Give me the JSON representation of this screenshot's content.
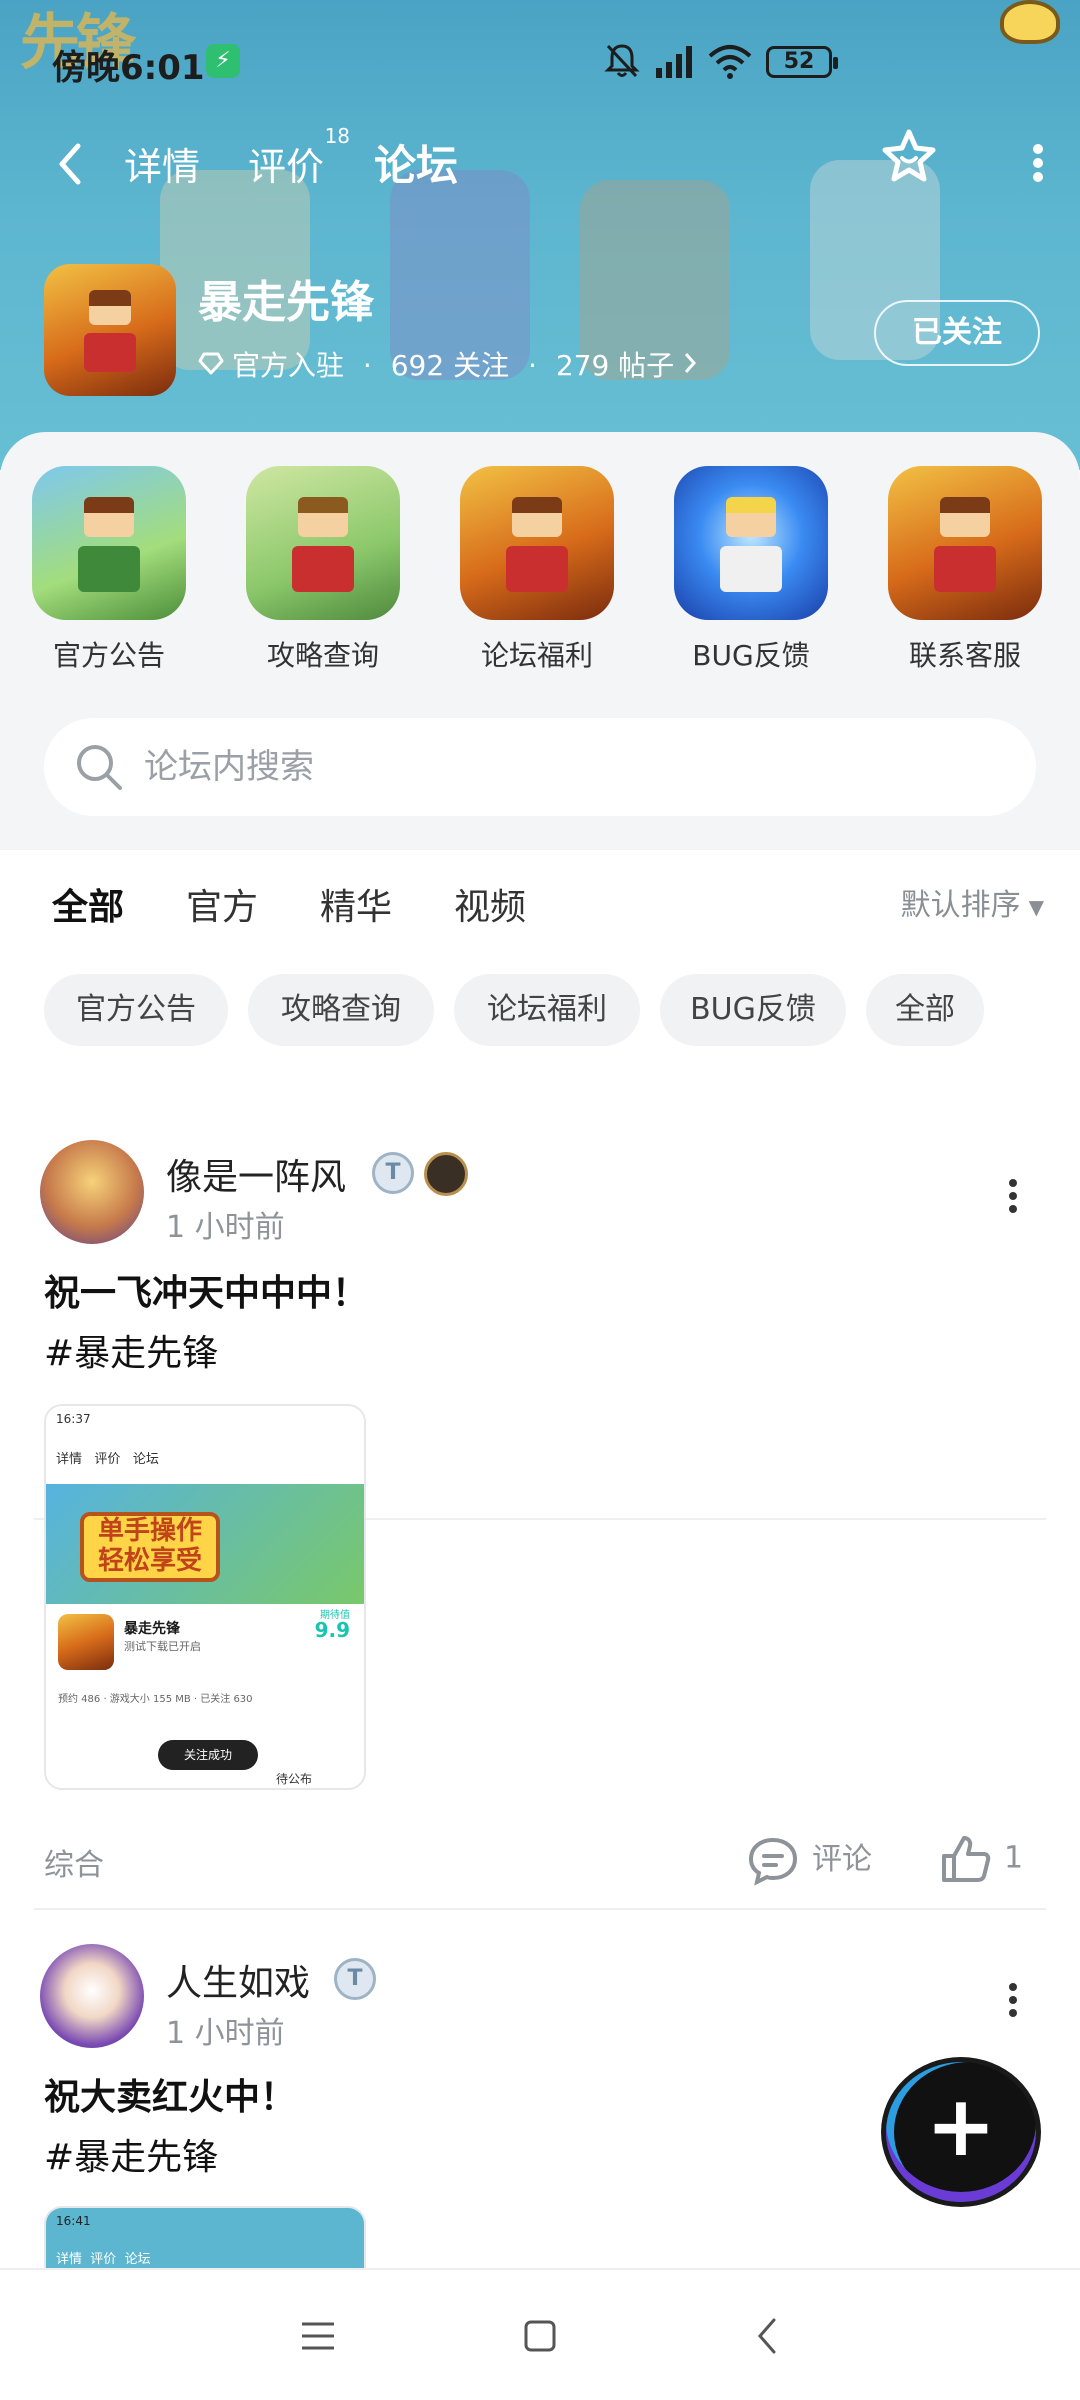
{
  "status": {
    "time": "傍晚6:01",
    "battery": "52"
  },
  "header": {
    "tabs": {
      "detail": "详情",
      "review": "评价",
      "review_count": "18",
      "forum": "论坛"
    },
    "game": {
      "name": "暴走先锋",
      "official": "官方入驻",
      "follows": "692 关注",
      "posts": "279 帖子",
      "separator": "·"
    },
    "follow_button": "已关注",
    "corner_logo": "先锋"
  },
  "shortcuts": [
    {
      "label": "官方公告"
    },
    {
      "label": "攻略查询"
    },
    {
      "label": "论坛福利"
    },
    {
      "label": "BUG反馈"
    },
    {
      "label": "联系客服"
    }
  ],
  "search": {
    "placeholder": "论坛内搜索"
  },
  "feed_tabs": {
    "all": "全部",
    "official": "官方",
    "featured": "精华",
    "video": "视频",
    "sort": "默认排序"
  },
  "chips": [
    {
      "label": "官方公告"
    },
    {
      "label": "攻略查询"
    },
    {
      "label": "论坛福利"
    },
    {
      "label": "BUG反馈"
    },
    {
      "label": "全部"
    }
  ],
  "posts": [
    {
      "user": "像是一阵风",
      "time": "1 小时前",
      "text": "祝一飞冲天中中中！",
      "tag": "#暴走先锋",
      "category": "综合",
      "comment_label": "评论",
      "likes": "1",
      "screenshot": {
        "status_time": "16:37",
        "tab_detail": "详情",
        "tab_review": "评价",
        "tab_forum": "论坛",
        "banner_text": "单手操作 轻松享受",
        "game_name": "暴走先锋",
        "game_sub": "测试下载已开启",
        "score_label": "期待值",
        "score": "9.9",
        "toast": "关注成功",
        "stats": "预约 486 · 游戏大小 155 MB · 已关注 630",
        "footer": "待公布"
      }
    },
    {
      "user": "人生如戏",
      "time": "1 小时前",
      "text": "祝大卖红火中！",
      "tag": "#暴走先锋",
      "screenshot": {
        "status_time": "16:41",
        "tab_detail": "详情",
        "tab_review": "评价",
        "tab_forum": "论坛"
      }
    }
  ],
  "colors": {
    "header_bg": "#5db6cf",
    "accent": "#3ee2c8"
  }
}
